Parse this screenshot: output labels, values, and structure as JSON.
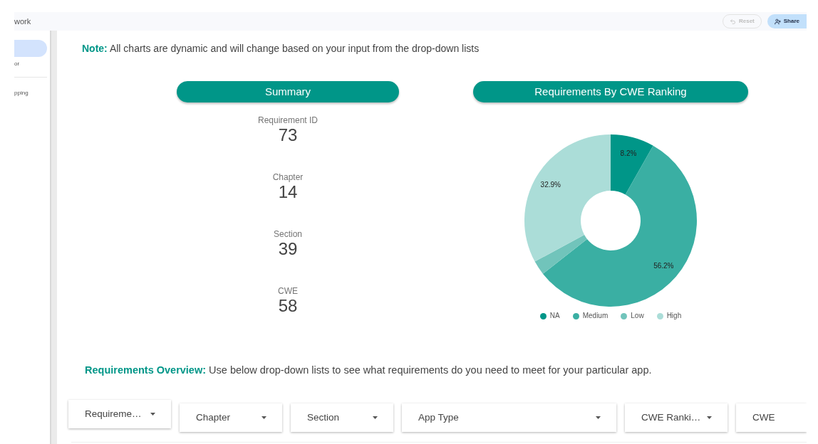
{
  "header": {
    "title": "work",
    "buttons": [
      {
        "kind": "reset",
        "label": "Reset",
        "disabled": true
      },
      {
        "kind": "share",
        "label": "Share",
        "disabled": false
      }
    ]
  },
  "sidebar": {
    "sections": [
      {
        "items": [
          {
            "selected": true
          },
          {
            "label": "or",
            "selected": false
          }
        ]
      },
      {
        "items": [
          {
            "label": "pping",
            "selected": false
          }
        ]
      }
    ]
  },
  "note": "**Note:** All charts are dynamic and will change based on your input from the drop-down lists",
  "summary": {
    "title": "Summary",
    "stats": [
      {
        "label": "Requirement ID",
        "value": "73"
      },
      {
        "label": "Chapter",
        "value": "14"
      },
      {
        "label": "Section",
        "value": "39"
      },
      {
        "label": "CWE",
        "value": "58"
      }
    ]
  },
  "cwe_chart": {
    "title": "Requirements By CWE Ranking",
    "chart_data": {
      "type": "donut",
      "categories": [
        "NA",
        "Medium",
        "Low",
        "High"
      ],
      "values": [
        8.2,
        56.2,
        2.7,
        32.9
      ],
      "colors": [
        "#009688",
        "#3aafa3",
        "#71c4bb",
        "#abddd8"
      ],
      "value_labels": [
        "8.2%",
        "56.2%",
        null,
        "32.9%"
      ],
      "legend": "bottom"
    }
  },
  "overview": "**Requirements Overview:** Use below drop-down lists to see what requirements do you need to meet for your particular app.",
  "filters": [
    {
      "label": "Requireme…",
      "caret": true
    },
    {
      "label": "Chapter",
      "caret": true
    },
    {
      "label": "Section",
      "caret": true
    },
    {
      "label": "App Type",
      "caret": true
    },
    {
      "label": "CWE Ranki…",
      "caret": true
    },
    {
      "label": "CWE",
      "caret": false
    }
  ]
}
